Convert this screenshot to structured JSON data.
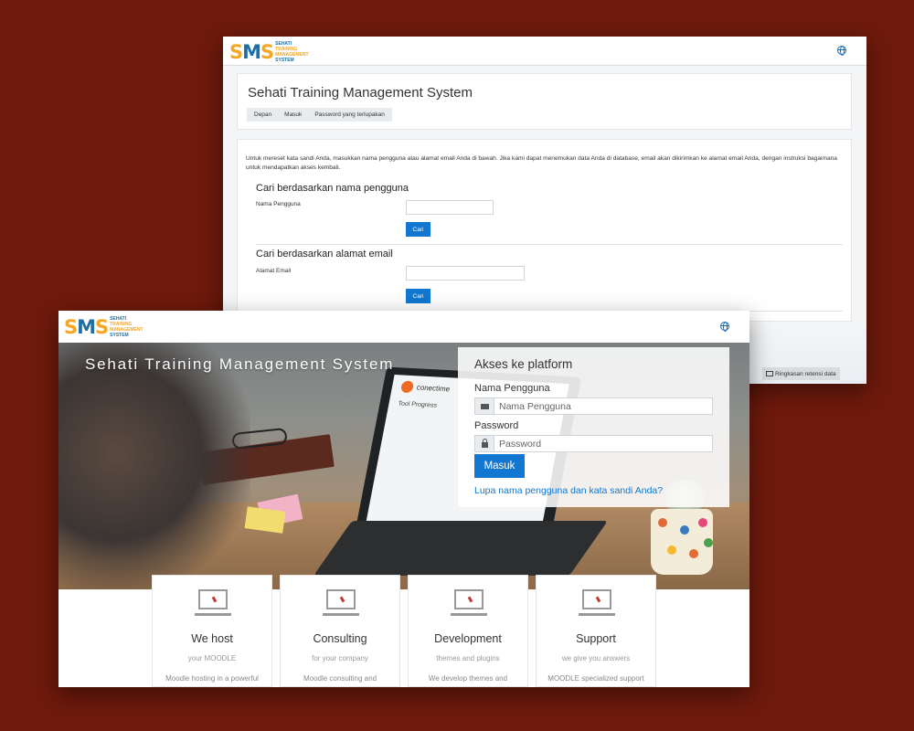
{
  "logo": {
    "letters": "SMS",
    "line1": "SEHATI",
    "line2": "TRAINING",
    "line3": "MANAGEMENT",
    "line4": "SYSTEM"
  },
  "back_window": {
    "page_title": "Sehati Training Management System",
    "breadcrumb": [
      "Depan",
      "Masuk",
      "Password yang terlupakan"
    ],
    "intro": "Untuk mereset kata sandi Anda, masukkan nama pengguna atau alamat email Anda di bawah. Jika kami dapat menemukan data Anda di database, email akan dikirimkan ke alamat email Anda, dengan instruksi bagaimana untuk mendapatkan akses kembali.",
    "by_username": {
      "title": "Cari berdasarkan nama pengguna",
      "label": "Nama Pengguna",
      "value": "",
      "button": "Cari"
    },
    "by_email": {
      "title": "Cari berdasarkan alamat email",
      "label": "Alamat Email",
      "value": "",
      "button": "Cari"
    },
    "footer_button": "Ringkasan retensi data"
  },
  "front_window": {
    "hero_title": "Sehati Training Management System",
    "laptop": {
      "brand": "conectime",
      "heading": "Tool Progress"
    },
    "login": {
      "title": "Akses ke platform",
      "username_label": "Nama Pengguna",
      "username_placeholder": "Nama Pengguna",
      "password_label": "Password",
      "password_placeholder": "Password",
      "submit": "Masuk",
      "forgot": "Lupa nama pengguna dan kata sandi Anda?"
    },
    "services": [
      {
        "title": "We host",
        "subtitle": "your MOODLE",
        "desc": "Moodle hosting in a powerful"
      },
      {
        "title": "Consulting",
        "subtitle": "for your company",
        "desc": "Moodle consulting and"
      },
      {
        "title": "Development",
        "subtitle": "themes and plugins",
        "desc": "We develop themes and"
      },
      {
        "title": "Support",
        "subtitle": "we give you answers",
        "desc": "MOODLE specialized support"
      }
    ]
  },
  "colors": {
    "background": "#6e1a0c",
    "primary": "#1177d1",
    "logo_orange": "#f5a623",
    "logo_blue": "#1d6fa5"
  },
  "icons": [
    "globe-icon",
    "envelope-icon",
    "lock-icon",
    "folder-icon",
    "monitor-icon"
  ]
}
